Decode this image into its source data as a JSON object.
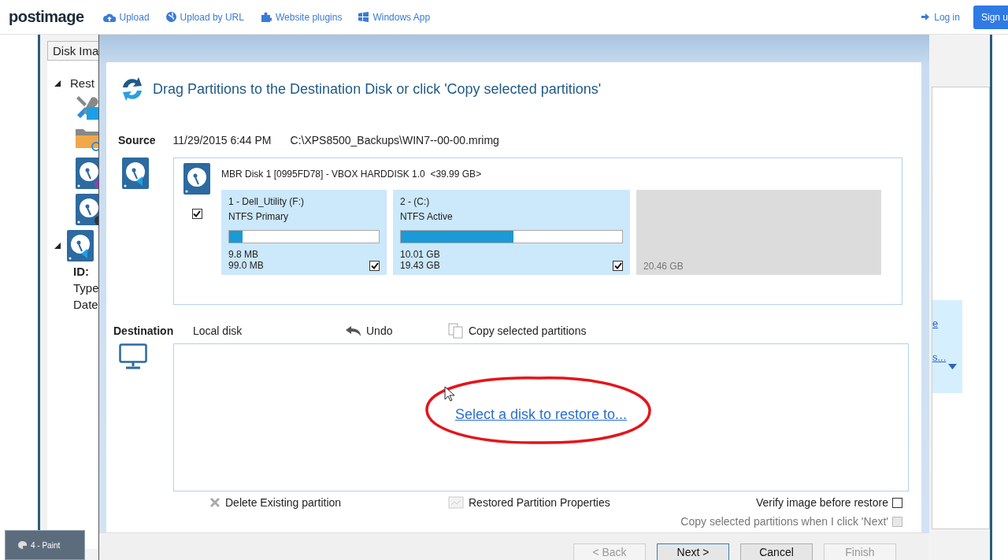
{
  "site_nav": {
    "logo": "postimage",
    "links": [
      {
        "label": "Upload",
        "kind": "upload"
      },
      {
        "label": "Upload by URL",
        "kind": "url"
      },
      {
        "label": "Website plugins",
        "kind": "plugins"
      },
      {
        "label": "Windows App",
        "kind": "windows"
      }
    ],
    "login": "Log in",
    "signup": "Sign u"
  },
  "background_window": {
    "tab": "Disk Ima",
    "tree_header": "Rest",
    "info_labels": [
      {
        "label": "ID:",
        "bold": true
      },
      {
        "label": "Type",
        "bold": false
      },
      {
        "label": "Date",
        "bold": false
      }
    ],
    "side_links": [
      "e",
      "s..."
    ]
  },
  "dialog": {
    "heading": "Drag Partitions to the Destination Disk or click 'Copy selected partitions'",
    "source": {
      "label": "Source",
      "date": "11/29/2015 6:44 PM",
      "path": "C:\\XPS8500_Backups\\WIN7--00-00.mrimg",
      "disk": {
        "title": "MBR Disk 1 [0995FD78] - VBOX HARDDISK 1.0  <39.99 GB>",
        "checked": true,
        "partitions": [
          {
            "kind": "partition",
            "name": "1 - Dell_Utility (F:)",
            "type": "NTFS Primary",
            "level": 0.09,
            "used": "9.8 MB",
            "size": "99.0 MB",
            "checked": true
          },
          {
            "kind": "partition",
            "name": "2 -  (C:)",
            "type": "NTFS Active",
            "level": 0.51,
            "used": "10.01 GB",
            "size": "19.43 GB",
            "checked": true
          },
          {
            "kind": "unallocated",
            "size": "20.46 GB"
          }
        ]
      }
    },
    "destination": {
      "label": "Destination",
      "disk_type": "Local disk",
      "undo": "Undo",
      "copy": "Copy selected partitions",
      "link": "Select a disk to restore to..."
    },
    "actions": [
      {
        "label": "Delete Existing partition",
        "kind": "delete"
      },
      {
        "label": "Restored Partition Properties",
        "kind": "properties"
      }
    ],
    "options": [
      {
        "label": "Verify image before restore",
        "checked": false,
        "disabled": false
      },
      {
        "label": "Copy selected partitions when I click 'Next'",
        "checked": false,
        "disabled": true
      }
    ],
    "buttons": [
      {
        "label": "< Back",
        "disabled": true,
        "default": false
      },
      {
        "label": "Next >",
        "disabled": false,
        "default": true
      },
      {
        "label": "Cancel",
        "disabled": false,
        "default": false
      },
      {
        "label": "Finish",
        "disabled": true,
        "default": false
      }
    ]
  },
  "taskbar": {
    "label": "4 - Paint"
  }
}
